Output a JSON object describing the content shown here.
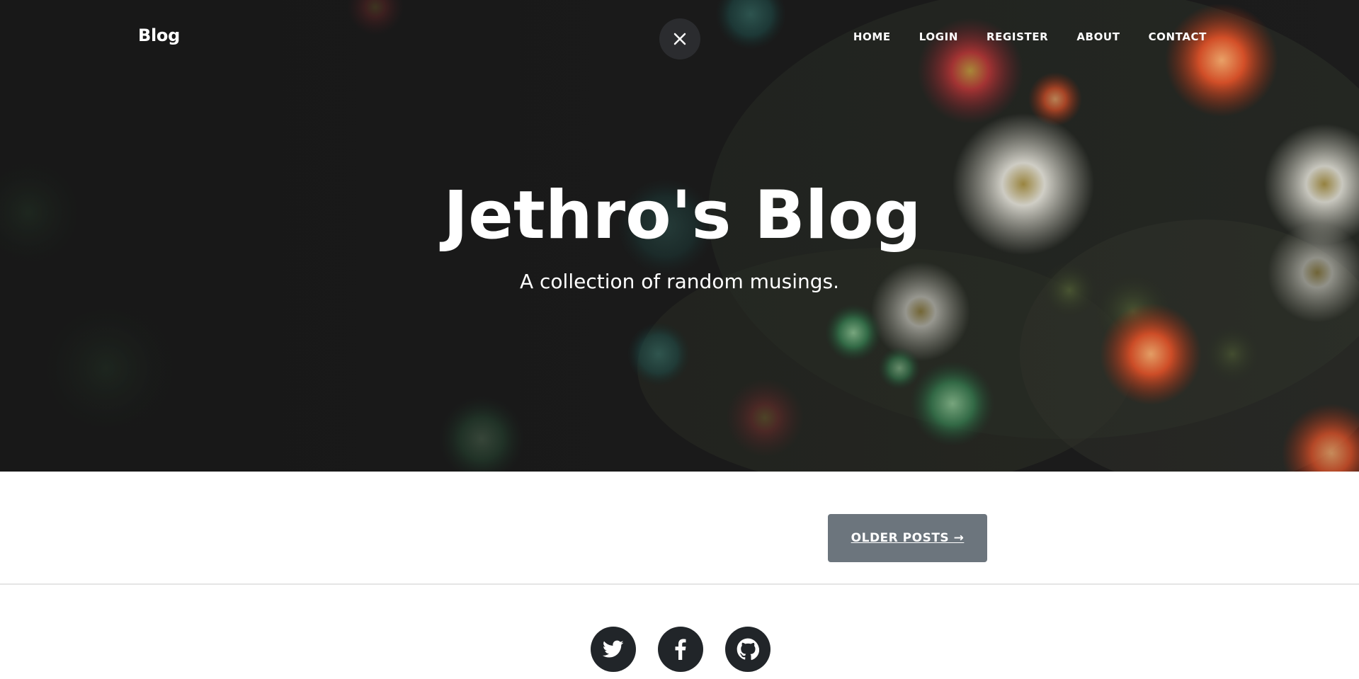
{
  "navbar": {
    "brand": "Blog",
    "close_icon": "close-icon",
    "links": [
      "HOME",
      "LOGIN",
      "REGISTER",
      "ABOUT",
      "CONTACT"
    ]
  },
  "hero": {
    "title": "Jethro's Blog",
    "subtitle": "A collection of random musings."
  },
  "pager": {
    "older_posts": "OLDER POSTS →"
  },
  "footer": {
    "social_icons": [
      "twitter-icon",
      "facebook-icon",
      "github-icon"
    ]
  },
  "colors": {
    "button_gray": "#6c757d",
    "social_dark": "#212529",
    "close_bg": "#2b2c2f",
    "divider": "#e5e5e5"
  }
}
